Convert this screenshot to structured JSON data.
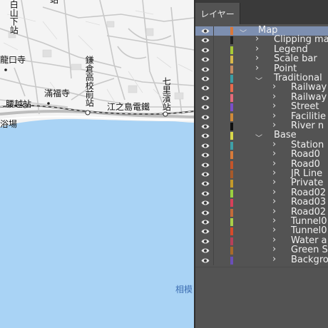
{
  "map": {
    "labels": {
      "stn_shimo": "白山下站",
      "ryukoji": "龍口寺",
      "kamakura": "鎌倉高校前站",
      "mampukuji": "滿福寺",
      "koshigoe": "腰越站",
      "yokujo": "浴場",
      "enoden": "江之島電鐵",
      "shichirigahama": "七里濱站",
      "top_fragment": "站",
      "sagami": "相模"
    }
  },
  "panel": {
    "tab_label": "レイヤー",
    "layers": [
      {
        "label": "Map",
        "depth": 0,
        "color": "#d9783a",
        "expanded": true,
        "selected": true
      },
      {
        "label": "Clipping ma",
        "depth": 1,
        "color": "#222222",
        "expanded": false
      },
      {
        "label": "Legend",
        "depth": 1,
        "color": "#a8c936",
        "expanded": false
      },
      {
        "label": "Scale bar",
        "depth": 1,
        "color": "#d8b94a",
        "expanded": false
      },
      {
        "label": "Point",
        "depth": 1,
        "color": "#c48a62",
        "expanded": false
      },
      {
        "label": "Traditional",
        "depth": 1,
        "color": "#3a9da5",
        "expanded": true
      },
      {
        "label": "Railway",
        "depth": 2,
        "color": "#e86a4c",
        "expanded": false
      },
      {
        "label": "Railway",
        "depth": 2,
        "color": "#e46a7a",
        "expanded": false
      },
      {
        "label": "Street",
        "depth": 2,
        "color": "#7a4fc8",
        "expanded": false
      },
      {
        "label": "Facilitie",
        "depth": 2,
        "color": "#cf8a3a",
        "expanded": false
      },
      {
        "label": "River n",
        "depth": 2,
        "color": "#111111",
        "expanded": false
      },
      {
        "label": "Base",
        "depth": 1,
        "color": "#d8d84a",
        "expanded": true
      },
      {
        "label": "Station",
        "depth": 2,
        "color": "#3fa0a8",
        "expanded": false
      },
      {
        "label": "Road0",
        "depth": 2,
        "color": "#d87a3a",
        "expanded": false
      },
      {
        "label": "Road0",
        "depth": 2,
        "color": "#c4552a",
        "expanded": false
      },
      {
        "label": "JR Line",
        "depth": 2,
        "color": "#a85a2a",
        "expanded": false
      },
      {
        "label": "Private",
        "depth": 2,
        "color": "#c49a2a",
        "expanded": false
      },
      {
        "label": "Road02",
        "depth": 2,
        "color": "#9ad040",
        "expanded": false
      },
      {
        "label": "Road03",
        "depth": 2,
        "color": "#d8405a",
        "expanded": false
      },
      {
        "label": "Road02",
        "depth": 2,
        "color": "#c46a3a",
        "expanded": false
      },
      {
        "label": "Tunnel0",
        "depth": 2,
        "color": "#a8d048",
        "expanded": false
      },
      {
        "label": "Tunnel0",
        "depth": 2,
        "color": "#d84a2a",
        "expanded": false
      },
      {
        "label": "Water a",
        "depth": 2,
        "color": "#b8405a",
        "expanded": false
      },
      {
        "label": "Green S",
        "depth": 2,
        "color": "#a86a2a",
        "expanded": false
      },
      {
        "label": "Backgro",
        "depth": 2,
        "color": "#6a4fb8",
        "expanded": false
      }
    ]
  }
}
